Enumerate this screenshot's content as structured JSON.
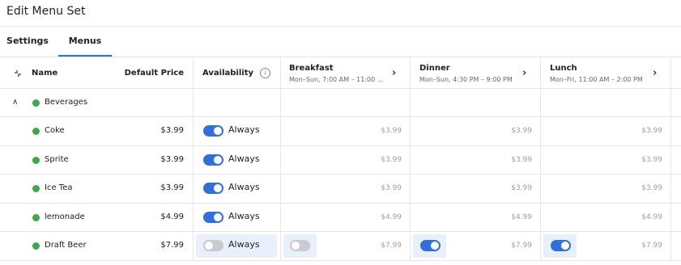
{
  "page": {
    "title": "Edit Menu Set"
  },
  "tabs": [
    {
      "label": "Settings",
      "active": false
    },
    {
      "label": "Menus",
      "active": true
    }
  ],
  "header": {
    "name": "Name",
    "default_price": "Default Price",
    "availability": "Availability",
    "info_icon": "info-icon",
    "menus": [
      {
        "label": "Breakfast",
        "schedule": "Mon–Sun, 7:00 AM – 11:00 ..."
      },
      {
        "label": "Dinner",
        "schedule": "Mon–Sun, 4:30 PM – 9:00 PM"
      },
      {
        "label": "Lunch",
        "schedule": "Mon–Fri, 11:00 AM – 2:00 PM"
      }
    ]
  },
  "group": {
    "label": "Beverages",
    "expanded": true,
    "status_color": "#3aa946"
  },
  "items": [
    {
      "name": "Coke",
      "price": "$3.99",
      "availability": "Always",
      "enabled": true,
      "menu_prices": [
        "$3.99",
        "$3.99",
        "$3.99"
      ],
      "menu_toggles": null
    },
    {
      "name": "Sprite",
      "price": "$3.99",
      "availability": "Always",
      "enabled": true,
      "menu_prices": [
        "$3.99",
        "$3.99",
        "$3.99"
      ],
      "menu_toggles": null
    },
    {
      "name": "Ice Tea",
      "price": "$3.99",
      "availability": "Always",
      "enabled": true,
      "menu_prices": [
        "$3.99",
        "$3.99",
        "$3.99"
      ],
      "menu_toggles": null
    },
    {
      "name": "lemonade",
      "price": "$4.99",
      "availability": "Always",
      "enabled": true,
      "menu_prices": [
        "$4.99",
        "$4.99",
        "$4.99"
      ],
      "menu_toggles": null
    },
    {
      "name": "Draft Beer",
      "price": "$7.99",
      "availability": "Always",
      "enabled": false,
      "menu_prices": [
        "$7.99",
        "$7.99",
        "$7.99"
      ],
      "menu_toggles": [
        false,
        true,
        true
      ]
    }
  ],
  "colors": {
    "accent": "#2f6fde",
    "status_green": "#3aa946",
    "highlight": "#e8f0fc"
  }
}
